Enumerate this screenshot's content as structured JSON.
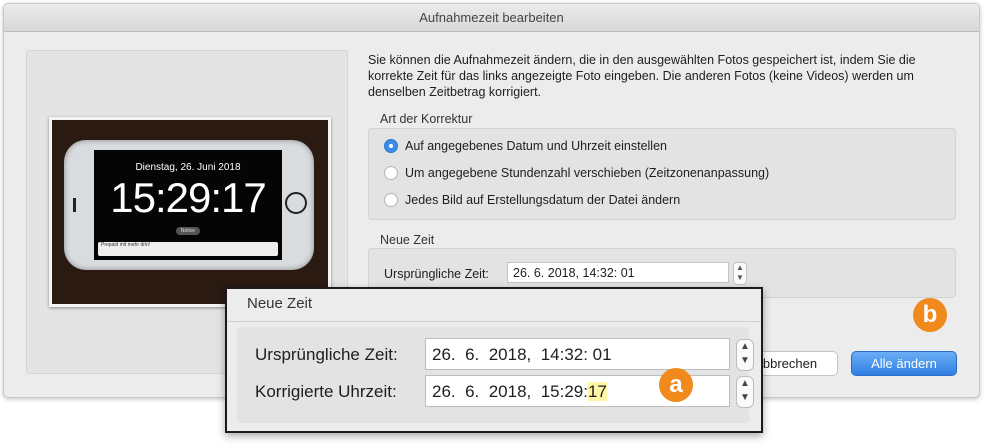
{
  "window": {
    "title": "Aufnahmezeit bearbeiten"
  },
  "preview": {
    "phone_date": "Dienstag, 26. Juni 2018",
    "phone_time": "15:29:17",
    "phone_notice": "Notice",
    "phone_bar_text": "Prepaid mit mehr drin!"
  },
  "description": "Sie können die Aufnahmezeit ändern, die in den ausgewählten Fotos gespeichert ist, indem Sie die korrekte Zeit für das links angezeigte Foto eingeben. Die anderen Fotos (keine Videos) werden um denselben Zeitbetrag korrigiert.",
  "correction": {
    "label": "Art der Korrektur",
    "options": [
      {
        "label": "Auf angegebenes Datum und Uhrzeit einstellen",
        "selected": true
      },
      {
        "label": "Um angegebene Stundenzahl verschieben (Zeitzonenanpassung)",
        "selected": false
      },
      {
        "label": "Jedes Bild auf Erstellungsdatum der Datei ändern",
        "selected": false
      }
    ]
  },
  "new_time": {
    "label": "Neue Zeit",
    "original_label": "Ursprüngliche Zeit:",
    "original_value": "26. 6. 2018, 14:32: 01"
  },
  "buttons": {
    "cancel": "bbrechen",
    "apply": "Alle ändern"
  },
  "zoom": {
    "title": "Neue Zeit",
    "original_label": "Ursprüngliche Zeit:",
    "original_value": "26.  6.  2018,  14:32: 01",
    "corrected_label": "Korrigierte Uhrzeit:",
    "corrected_value_prefix": "26.  6.  2018,  15:29:",
    "corrected_value_seconds": "17"
  },
  "badges": {
    "a": "a",
    "b": "b"
  },
  "colors": {
    "accent": "#3b8ce9",
    "badge": "#f08a1c",
    "highlight": "#fff6a8"
  }
}
